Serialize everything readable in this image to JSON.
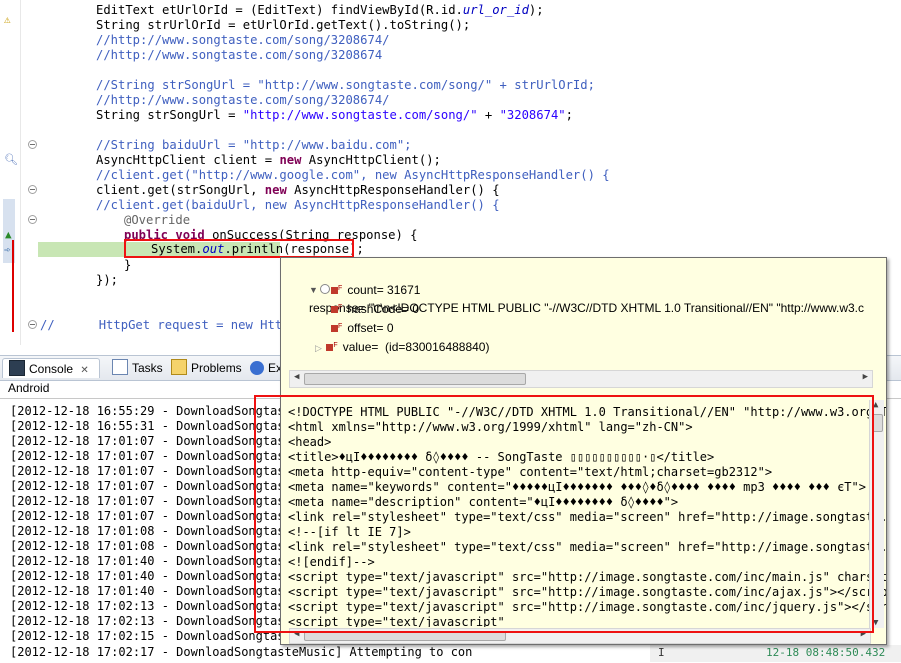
{
  "editor": {
    "lines": [
      {
        "top": "0",
        "parts": []
      },
      {
        "text_a": "EditText etUrlOrId = (EditText) findViewById(R.id.",
        "text_b": "url_or_id",
        "text_c": ");"
      },
      {
        "text": "String strUrlOrId = etUrlOrId.getText().toString();"
      },
      {
        "text": "//http://www.songtaste.com/song/3208674/"
      },
      {
        "text": "//http://www.songtaste.com/song/3208674"
      },
      {
        "text": "//String strSongUrl = \"http://www.songtaste.com/song/\" + strUrlOrId;"
      },
      {
        "text": "//http://www.songtaste.com/song/3208674/"
      },
      {
        "text_a": "String strSongUrl = ",
        "text_b": "\"http://www.songtaste.com/song/\"",
        "text_c": " + ",
        "text_d": "\"3208674\"",
        "text_e": ";"
      },
      {
        "text": "//String baiduUrl = \"http://www.baidu.com\";"
      },
      {
        "text_a": "AsyncHttpClient client = ",
        "text_b": "new",
        "text_c": " AsyncHttpClient();"
      },
      {
        "text": "//client.get(\"http://www.google.com\", new AsyncHttpResponseHandler() {"
      },
      {
        "text_a": "client.get(strSongUrl, ",
        "text_b": "new",
        "text_c": " AsyncHttpResponseHandler() {"
      },
      {
        "text": "//client.get(baiduUrl, new AsyncHttpResponseHandler() {"
      },
      {
        "text": "@Override"
      },
      {
        "text_a": "public",
        "text_b": "void",
        "text_c": " onSuccess(String response) {"
      },
      {
        "text_a": "System.",
        "text_b": "out",
        "text_c": ".println(response);"
      },
      {
        "text": "}"
      },
      {
        "text": "});"
      },
      {
        "text_a": "//",
        "text_b": "HttpGet request = new HttpG"
      }
    ]
  },
  "tabs": [
    {
      "label": "Console",
      "close": "✕"
    },
    {
      "label": "Tasks"
    },
    {
      "label": "Problems"
    },
    {
      "label": "Ex"
    }
  ],
  "console": {
    "label": "Android",
    "lines": [
      "[2012-12-18 16:55:29 - DownloadSongtaste",
      "[2012-12-18 16:55:31 - DownloadSongtaste",
      "[2012-12-18 17:01:07 - DownloadSongtaste",
      "[2012-12-18 17:01:07 - DownloadSongtaste",
      "[2012-12-18 17:01:07 - DownloadSongtaste",
      "[2012-12-18 17:01:07 - DownloadSongtaste",
      "[2012-12-18 17:01:07 - DownloadSongtaste",
      "[2012-12-18 17:01:07 - DownloadSongtaste",
      "[2012-12-18 17:01:08 - DownloadSongtaste",
      "[2012-12-18 17:01:08 - DownloadSongtaste",
      "[2012-12-18 17:01:40 - DownloadSongtaste",
      "[2012-12-18 17:01:40 - DownloadSongtaste",
      "[2012-12-18 17:01:40 - DownloadSongtaste",
      "[2012-12-18 17:02:13 - DownloadSongtaste",
      "[2012-12-18 17:02:13 - DownloadSongtaste",
      "[2012-12-18 17:02:15 - DownloadSongtaste",
      "[2012-12-18 17:02:17 - DownloadSongtasteMusic] Attempting to con"
    ],
    "status_timestamp": "12-18 08:48:50.432",
    "status_sep": "I"
  },
  "popup": {
    "root": {
      "name": "response",
      "value": "\"\\r\\n<!DOCTYPE HTML PUBLIC \"-//W3C//DTD XHTML 1.0 Transitional//EN\" \"http://www.w3.c"
    },
    "fields": [
      {
        "text": "count= 31671"
      },
      {
        "text": "hashCode= 0"
      },
      {
        "text": "offset= 0"
      },
      {
        "text": "value=  (id=830016488840)"
      }
    ],
    "detail_lines": [
      "<!DOCTYPE HTML PUBLIC \"-//W3C//DTD XHTML 1.0 Transitional//EN\" \"http://www.w3.org/T",
      "<html xmlns=\"http://www.w3.org/1999/xhtml\" lang=\"zh-CN\">",
      "<head>",
      "<title>♦цI♦♦♦♦♦♦♦♦ δ◊♦♦♦♦ -- SongTaste ▯▯▯▯▯▯▯▯▯▯·▯</title>",
      "<meta http-equiv=\"content-type\" content=\"text/html;charset=gb2312\">",
      "<meta name=\"keywords\" content=\"♦♦♦♦♦цI♦♦♦♦♦♦♦ ♦♦♦◊♦δ◊♦♦♦♦ ♦♦♦♦ mp3 ♦♦♦♦ ♦♦♦ єT\">",
      "<meta name=\"description\" content=\"♦цI♦♦♦♦♦♦♦♦ δ◊♦♦♦♦\">",
      "<link rel=\"stylesheet\" type=\"text/css\" media=\"screen\" href=\"http://image.songtaste.",
      "<!--[if lt IE 7]>",
      "<link rel=\"stylesheet\" type=\"text/css\" media=\"screen\" href=\"http://image.songtaste.",
      "<![endif]-->",
      "<script type=\"text/javascript\" src=\"http://image.songtaste.com/inc/main.js\" charset",
      "<script type=\"text/javascript\" src=\"http://image.songtaste.com/inc/ajax.js\"></scrip",
      "<script type=\"text/javascript\" src=\"http://image.songtaste.com/inc/jquery.js\"></scr",
      "<script type=\"text/javascript\""
    ]
  }
}
